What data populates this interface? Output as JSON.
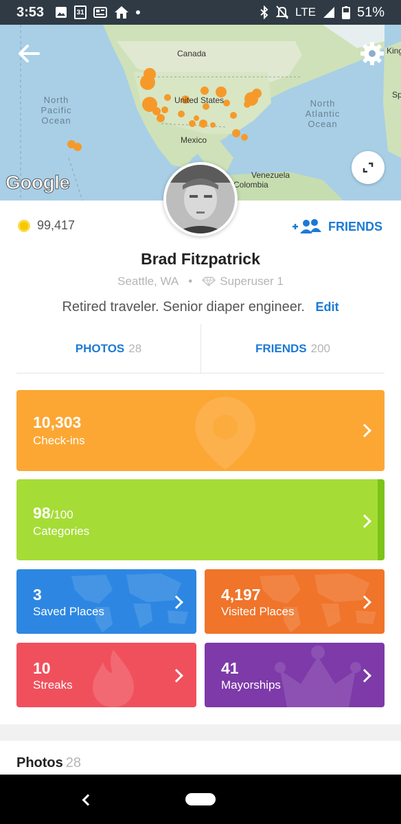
{
  "status_bar": {
    "time": "3:53",
    "calendar_day": "31",
    "network": "LTE",
    "battery": "51%",
    "icons": [
      "image-icon",
      "calendar-icon",
      "news-icon",
      "home-icon",
      "dot-icon",
      "bluetooth-icon",
      "mute-icon",
      "signal-icon",
      "battery-icon"
    ]
  },
  "map": {
    "labels": {
      "canada": "Canada",
      "united_states": "United States",
      "mexico": "Mexico",
      "venezuela": "Venezuela",
      "colombia": "Colombia",
      "king": "King",
      "sp": "Sp"
    },
    "oceans": {
      "north_pacific": [
        "North",
        "Pacific",
        "Ocean"
      ],
      "north_atlantic": [
        "North",
        "Atlantic",
        "Ocean"
      ]
    },
    "google_logo": "Google",
    "marker_color": "#f59a2a"
  },
  "profile": {
    "coins": "99,417",
    "friends_link": "FRIENDS",
    "name": "Brad Fitzpatrick",
    "location": "Seattle, WA",
    "superuser": "Superuser 1",
    "bio": "Retired traveler. Senior diaper engineer.",
    "edit": "Edit"
  },
  "tabs": [
    {
      "label": "PHOTOS",
      "count": "28"
    },
    {
      "label": "FRIENDS",
      "count": "200"
    }
  ],
  "stats": {
    "checkins": {
      "value": "10,303",
      "label": "Check-ins",
      "color": "#fca734"
    },
    "categories": {
      "value": "98",
      "total": "/100",
      "label": "Categories",
      "color": "#a6dc36"
    },
    "saved": {
      "value": "3",
      "label": "Saved Places",
      "color": "#2d87e2"
    },
    "visited": {
      "value": "4,197",
      "label": "Visited Places",
      "color": "#f0742a"
    },
    "streaks": {
      "value": "10",
      "label": "Streaks",
      "color": "#f0505c"
    },
    "mayorships": {
      "value": "41",
      "label": "Mayorships",
      "color": "#7d3aa8"
    }
  },
  "photos_section": {
    "title": "Photos",
    "count": "28"
  },
  "colors": {
    "accent": "#1b7ad6",
    "coin": "#f7c700"
  }
}
